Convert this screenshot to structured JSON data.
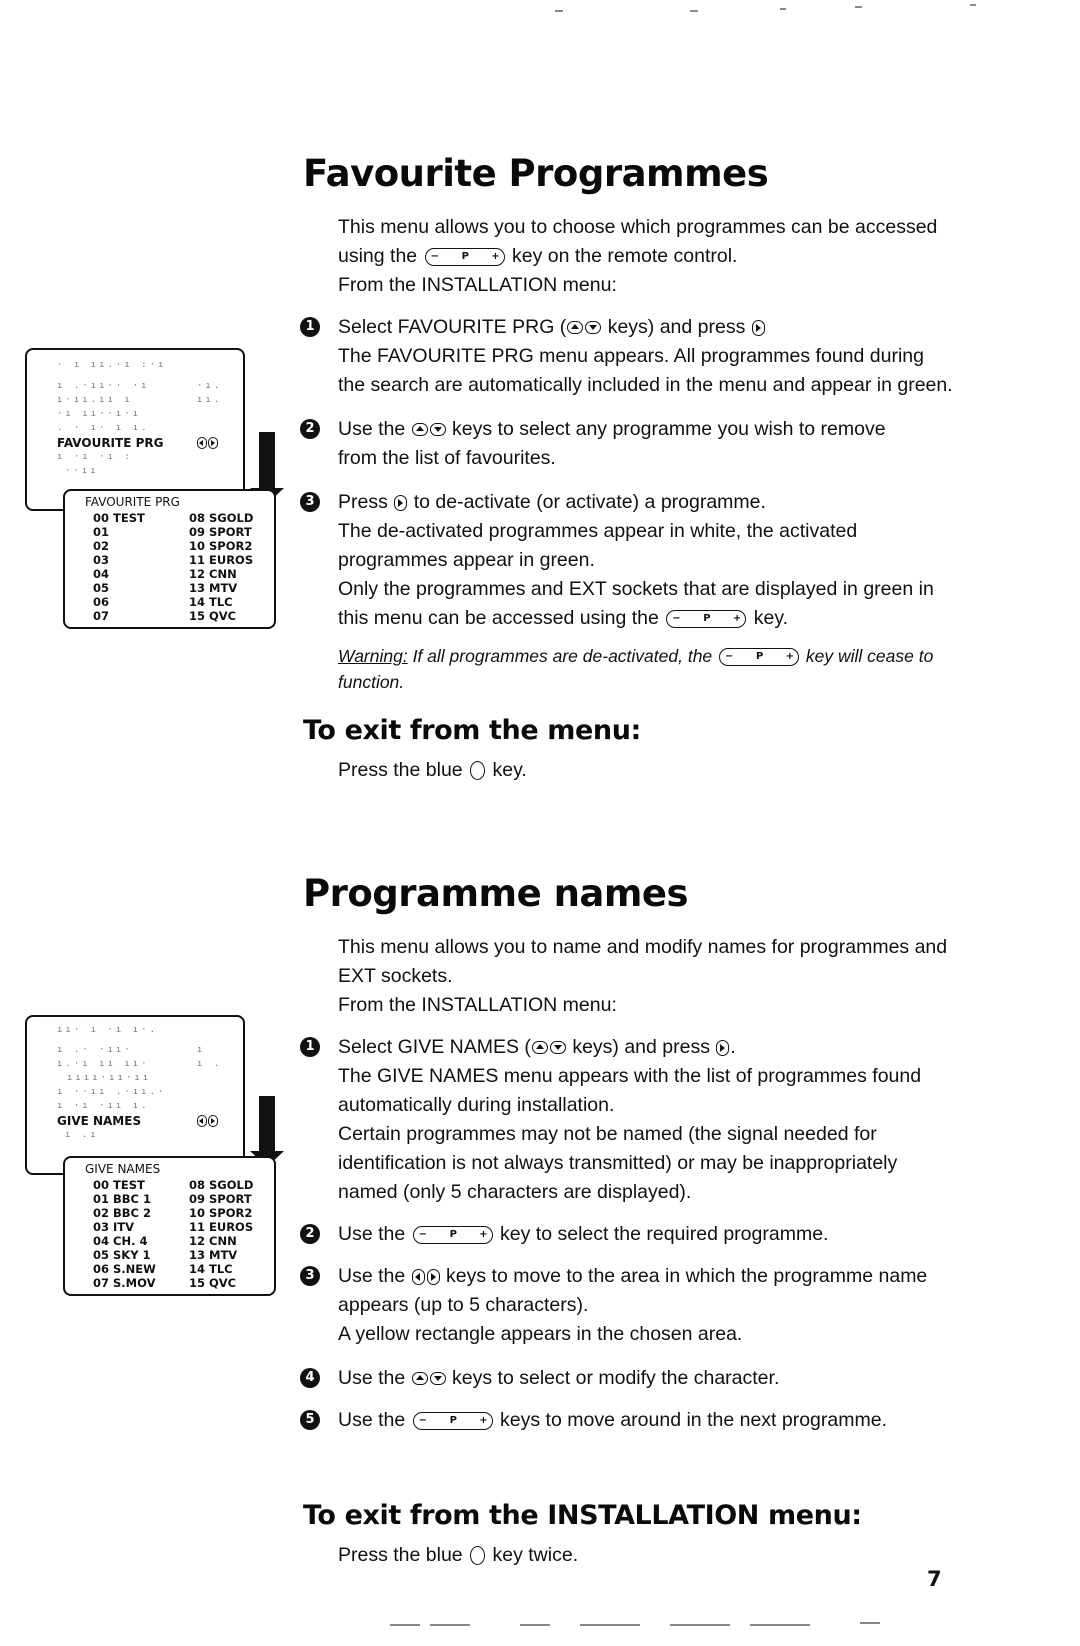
{
  "section1": {
    "title": "Favourite Programmes",
    "intro_1a": "This menu allows you to choose which programmes can be accessed",
    "intro_2a": "using the",
    "intro_2b": "key on the remote control.",
    "intro_3": "From the INSTALLATION menu:",
    "steps": [
      {
        "num": "1",
        "line1a": "Select FAVOURITE PRG (",
        "line1b": "keys) and press",
        "line2": "The FAVOURITE PRG menu appears. All programmes found during",
        "line3": "the search are automatically included in the menu and appear in green."
      },
      {
        "num": "2",
        "line1a": "Use the",
        "line1b": "keys to select any programme you wish to remove",
        "line2": "from the list of favourites."
      },
      {
        "num": "3",
        "line1a": "Press",
        "line1b": "to de-activate (or activate) a programme.",
        "line2": "The de-activated programmes appear in white, the activated",
        "line3": "programmes appear in green.",
        "line4": "Only the programmes and EXT sockets that are displayed in green in",
        "line5a": "this menu can be accessed using the",
        "line5b": "key."
      }
    ],
    "warning_label": "Warning:",
    "warning_a": " If all programmes are de-activated, the",
    "warning_b": "key will cease to",
    "warning_c": "function.",
    "exit_title": "To exit from the menu:",
    "exit_a": "Press the blue",
    "exit_b": "key."
  },
  "section2": {
    "title": "Programme names",
    "intro_1": "This menu allows you to name and modify names for programmes and",
    "intro_2": "EXT sockets.",
    "intro_3": "From the INSTALLATION menu:",
    "steps": [
      {
        "num": "1",
        "line1a": "Select GIVE NAMES (",
        "line1b": "keys) and press",
        "line1c": ".",
        "line2": "The GIVE NAMES menu appears with the list of programmes found",
        "line3": "automatically during installation.",
        "line4": "Certain programmes may not be named (the signal needed for",
        "line5": "identification is not always transmitted) or may be inappropriately",
        "line6": "named (only 5 characters are displayed)."
      },
      {
        "num": "2",
        "line1a": "Use the",
        "line1b": "key to select the required programme."
      },
      {
        "num": "3",
        "line1a": "Use the",
        "line1b": "keys to move to the area in which the programme name",
        "line2": "appears (up to 5 characters).",
        "line3": "A yellow rectangle appears in the chosen area."
      },
      {
        "num": "4",
        "line1a": "Use the",
        "line1b": "keys to select or modify the character."
      },
      {
        "num": "5",
        "line1a": "Use the",
        "line1b": "keys to move around in the next programme."
      }
    ],
    "exit_title": "To exit from the INSTALLATION menu:",
    "exit_a": "Press the blue",
    "exit_b": "key twice."
  },
  "keys": {
    "minus": "−",
    "p": "P",
    "plus": "+"
  },
  "menu1": {
    "back_selected": "FAVOURITE PRG",
    "front_title": "FAVOURITE PRG",
    "left_col": [
      "00 TEST",
      "01",
      "02",
      "03",
      "04",
      "05",
      "06",
      "07"
    ],
    "right_col": [
      "08 SGOLD",
      "09 SPORT",
      "10 SPOR2",
      "11 EUROS",
      "12 CNN",
      "13 MTV",
      "14 TLC",
      "15 QVC"
    ]
  },
  "menu2": {
    "back_selected": "GIVE NAMES",
    "front_title": "GIVE NAMES",
    "left_col": [
      "00 TEST",
      "01 BBC 1",
      "02 BBC 2",
      "03 ITV",
      "04 CH. 4",
      "05 SKY 1",
      "06 S.NEW",
      "07 S.MOV"
    ],
    "right_col": [
      "08 SGOLD",
      "09 SPORT",
      "10 SPOR2",
      "11 EUROS",
      "12 CNN",
      "13 MTV",
      "14 TLC",
      "15 QVC"
    ]
  },
  "page_number": "7"
}
